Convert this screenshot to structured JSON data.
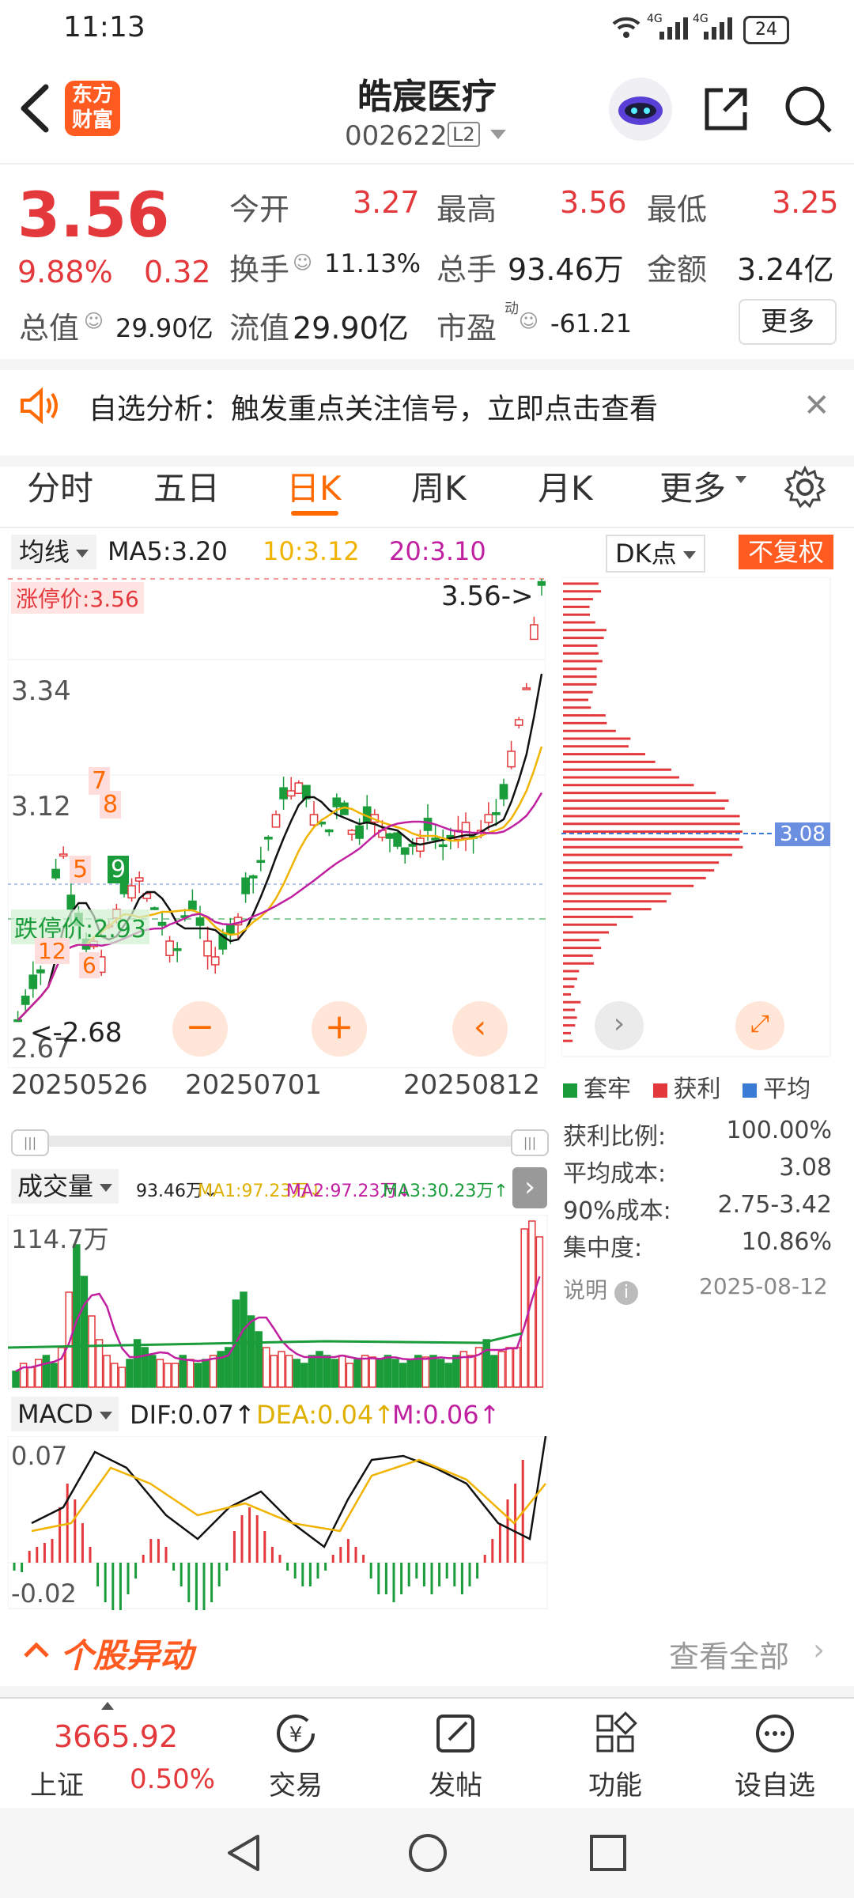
{
  "status": {
    "time": "11:13",
    "battery": "24",
    "signal1": "4G",
    "signal2": "4G"
  },
  "header": {
    "logo_text": "东方财富",
    "name": "皓宸医疗",
    "code": "002622",
    "level": "L2"
  },
  "quote": {
    "price": "3.56",
    "change_pct": "9.88%",
    "change": "0.32",
    "open_label": "今开",
    "open": "3.27",
    "high_label": "最高",
    "high": "3.56",
    "low_label": "最低",
    "low": "3.25",
    "turnover_label": "换手",
    "turnover": "11.13%",
    "volume_label": "总手",
    "volume": "93.46万",
    "amount_label": "金额",
    "amount": "3.24亿",
    "mktcap_label": "总值",
    "mktcap": "29.90亿",
    "float_label": "流值",
    "float": "29.90亿",
    "pe_label": "市盈",
    "pe_sup": "动",
    "pe": "-61.21",
    "more": "更多"
  },
  "banner": {
    "text": "自选分析：触发重点关注信号，立即点击查看"
  },
  "tabs": [
    "分时",
    "五日",
    "日K",
    "周K",
    "月K",
    "更多"
  ],
  "ma": {
    "selector": "均线",
    "ma5": "MA5:3.20",
    "ma10": "10:3.12",
    "ma20": "20:3.10",
    "dk": "DK点",
    "adjust": "不复权"
  },
  "kchart": {
    "limit_up": "涨停价:3.56",
    "limit_down": "跌停价:2.93",
    "y1": "3.34",
    "y2": "3.12",
    "y3": "2.67",
    "y_partial": "3.56",
    "last_price": "3.56->",
    "low_marker": "<-2.68",
    "signals": [
      "7",
      "8",
      "5",
      "9",
      "12",
      "6"
    ],
    "dates": [
      "20250526",
      "20250701",
      "20250812"
    ]
  },
  "chip": {
    "avg_tag": "3.08",
    "legend": [
      "套牢",
      "获利",
      "平均"
    ],
    "rows": [
      {
        "label": "获利比例:",
        "value": "100.00%"
      },
      {
        "label": "平均成本:",
        "value": "3.08"
      },
      {
        "label": "90%成本:",
        "value": "2.75-3.42"
      },
      {
        "label": "集中度:",
        "value": "10.86%"
      }
    ],
    "note": "说明",
    "date": "2025-08-12"
  },
  "volume": {
    "selector": "成交量",
    "cur": "93.46万↓",
    "ma1": "MA1:97.23万↓",
    "ma2": "MA2:97.23万↓",
    "ma3": "MA3:30.23万↑",
    "ymax": "114.7万"
  },
  "macd": {
    "selector": "MACD",
    "dif": "DIF:0.07↑",
    "dea": "DEA:0.04↑",
    "m": "M:0.06↑",
    "ymax": "0.07",
    "ymin": "-0.02"
  },
  "section": {
    "title": "个股异动",
    "more": "查看全部"
  },
  "bottom": {
    "index_value": "3665.92",
    "index_name": "上证",
    "index_pct": "0.50%",
    "items": [
      "交易",
      "发帖",
      "功能",
      "设自选"
    ]
  },
  "colors": {
    "up": "#e4393c",
    "down": "#1a9c3b",
    "accent": "#ff6a00",
    "ma10": "#f0b400",
    "ma20": "#c020a0"
  },
  "chart_data": {
    "type": "bar",
    "categories": [
      "套牢",
      "获利",
      "平均"
    ],
    "values": [
      0,
      100,
      3.08
    ],
    "title": "",
    "xlabel": "",
    "ylabel": ""
  }
}
